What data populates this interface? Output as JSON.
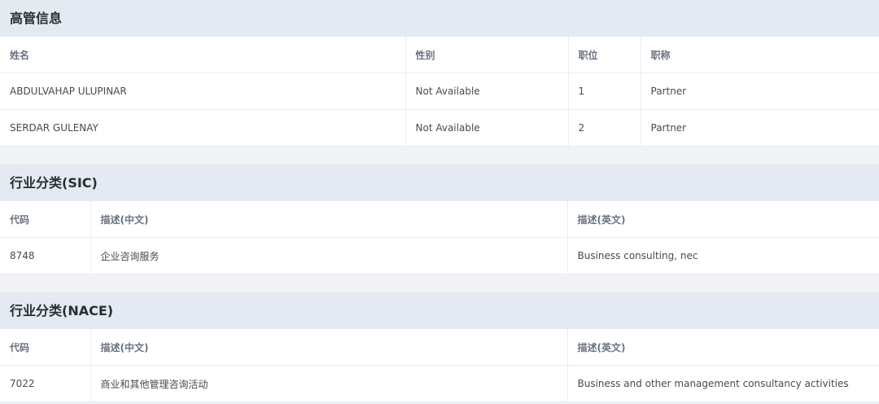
{
  "executives": {
    "title": "高管信息",
    "headers": [
      "姓名",
      "性别",
      "职位",
      "职称"
    ],
    "rows": [
      [
        "ABDULVAHAP ULUPINAR",
        "Not Available",
        "1",
        "Partner"
      ],
      [
        "SERDAR GULENAY",
        "Not Available",
        "2",
        "Partner"
      ]
    ]
  },
  "sic": {
    "title": "行业分类(SIC)",
    "headers": [
      "代码",
      "描述(中文)",
      "描述(英文)"
    ],
    "rows": [
      [
        "8748",
        "企业咨询服务",
        "Business consulting, nec"
      ]
    ]
  },
  "nace": {
    "title": "行业分类(NACE)",
    "headers": [
      "代码",
      "描述(中文)",
      "描述(英文)"
    ],
    "rows": [
      [
        "7022",
        "商业和其他管理咨询活动",
        "Business and other management consultancy activities"
      ]
    ]
  }
}
